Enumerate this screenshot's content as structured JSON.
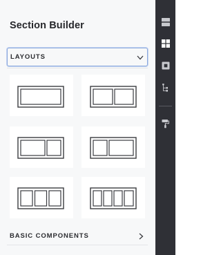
{
  "panel": {
    "title": "Section Builder"
  },
  "sections": [
    {
      "label": "LAYOUTS",
      "expanded": true
    },
    {
      "label": "BASIC COMPONENTS",
      "expanded": false
    }
  ],
  "layouts": [
    {
      "name": "one-column",
      "columns": [
        1
      ]
    },
    {
      "name": "two-equal-columns",
      "columns": [
        1,
        1
      ]
    },
    {
      "name": "two-columns-wide-left",
      "columns": [
        2,
        1
      ]
    },
    {
      "name": "two-columns-wide-right",
      "columns": [
        1,
        2
      ]
    },
    {
      "name": "three-columns",
      "columns": [
        1,
        1,
        1
      ]
    },
    {
      "name": "four-columns",
      "columns": [
        1,
        1,
        1,
        1
      ]
    }
  ],
  "sidebar": {
    "items": [
      {
        "name": "page-elements-icon"
      },
      {
        "name": "layouts-grid-icon",
        "active": true
      },
      {
        "name": "widgets-icon"
      },
      {
        "name": "structure-tree-icon"
      },
      {
        "name": "paint-roller-icon"
      }
    ]
  },
  "colors": {
    "panel_bg": "#f7f8f9",
    "rail_bg": "#2f3036",
    "rail_icon": "#c8c9ce",
    "rail_icon_active": "#ffffff",
    "focus_border": "#8aa7dc",
    "layout_stroke": "#3a3b3f"
  }
}
